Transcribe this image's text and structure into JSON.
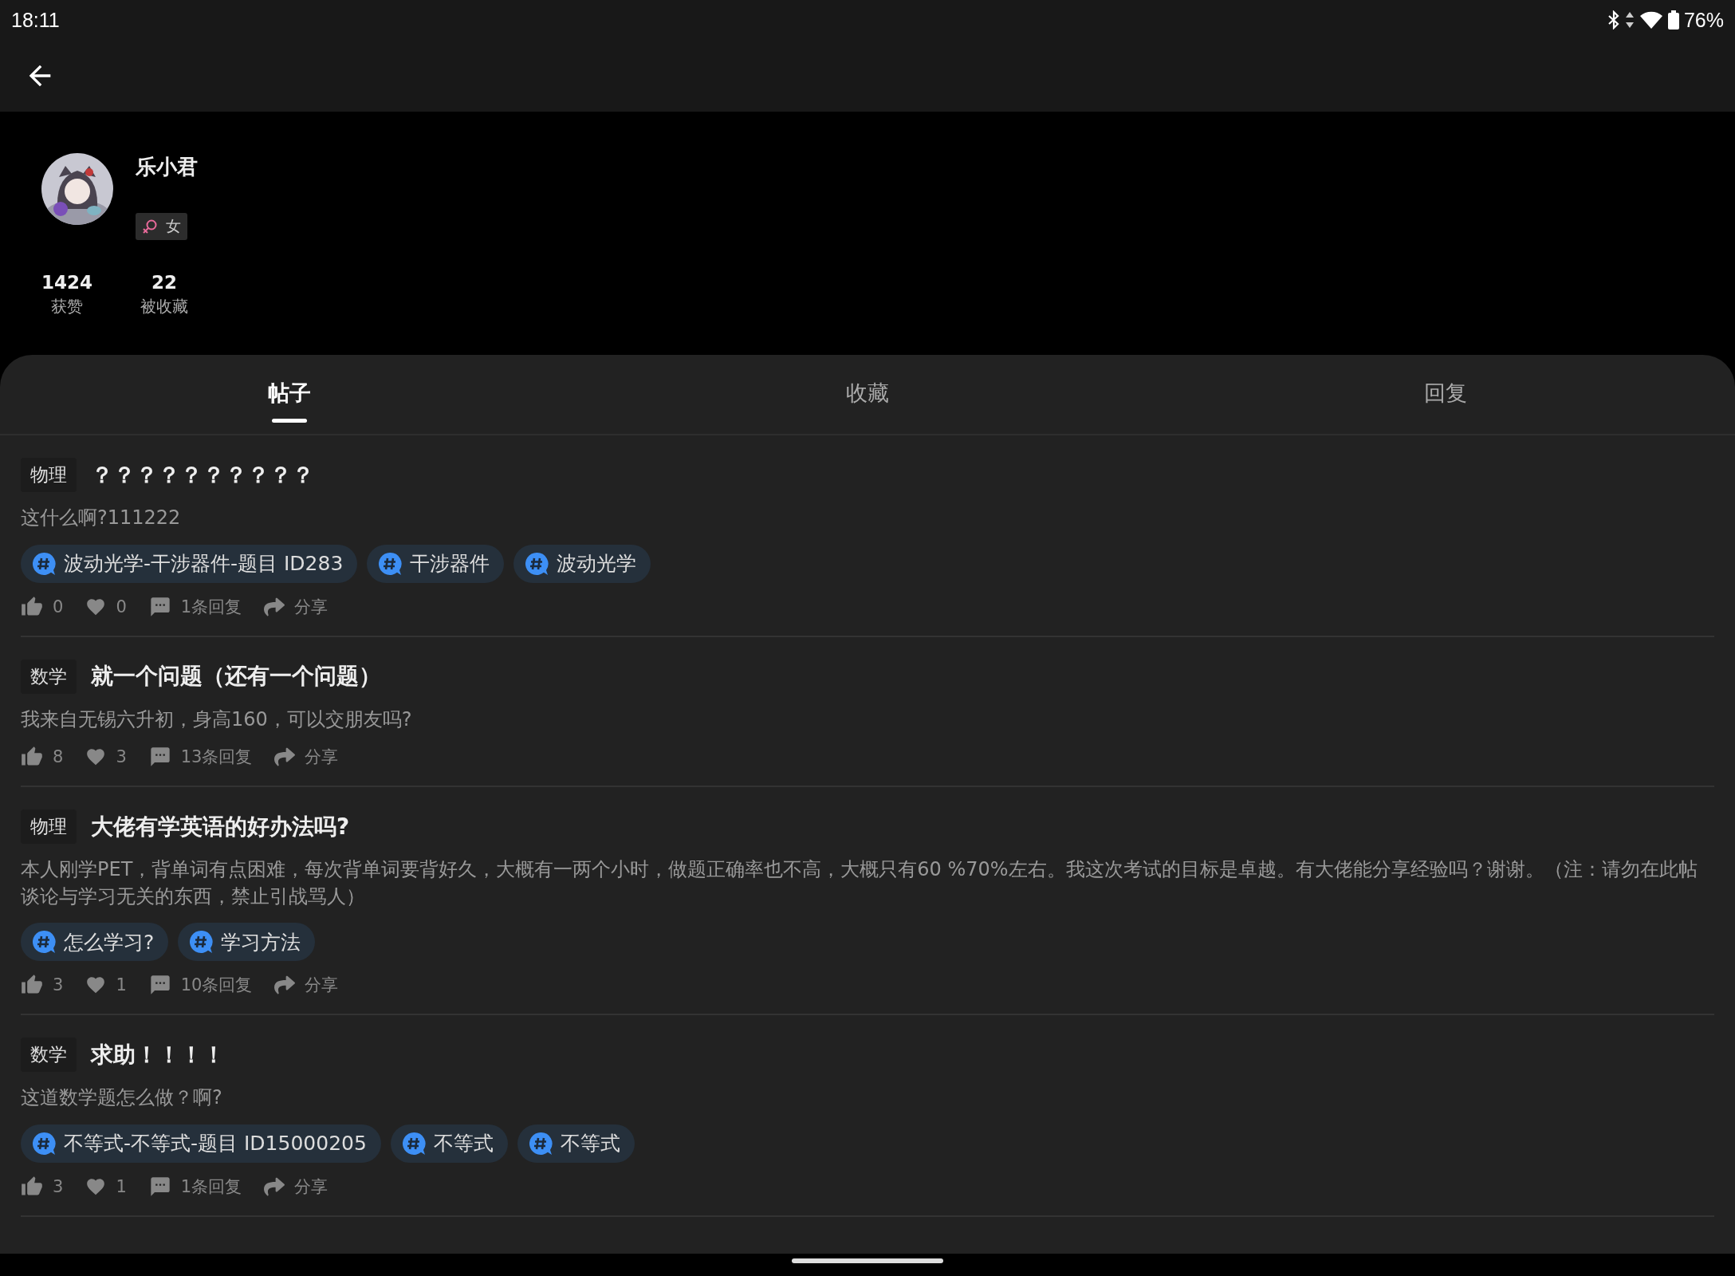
{
  "status_bar": {
    "time": "18:11",
    "battery": "76%"
  },
  "profile": {
    "name": "乐小君",
    "gender": "女",
    "stats": [
      {
        "value": "1424",
        "label": "获赞"
      },
      {
        "value": "22",
        "label": "被收藏"
      }
    ]
  },
  "tabs": [
    {
      "label": "帖子",
      "selected": true
    },
    {
      "label": "收藏",
      "selected": false
    },
    {
      "label": "回复",
      "selected": false
    }
  ],
  "posts": [
    {
      "subject": "物理",
      "title": "？？？？？？？？？？",
      "body": "这什么啊?111222",
      "tags": [
        "波动光学-干涉器件-题目 ID283",
        "干涉器件",
        "波动光学"
      ],
      "likes": "0",
      "favorites": "0",
      "replies": "1条回复",
      "share": "分享"
    },
    {
      "subject": "数学",
      "title": "就一个问题（还有一个问题）",
      "body": "我来自无锡六升初，身高160，可以交朋友吗?",
      "likes": "8",
      "favorites": "3",
      "replies": "13条回复",
      "share": "分享"
    },
    {
      "subject": "物理",
      "title": "大佬有学英语的好办法吗?",
      "body": "本人刚学PET，背单词有点困难，每次背单词要背好久，大概有一两个小时，做题正确率也不高，大概只有60 %70%左右。我这次考试的目标是卓越。有大佬能分享经验吗？谢谢。（注：请勿在此帖谈论与学习无关的东西，禁止引战骂人）",
      "tags": [
        "怎么学习?",
        "学习方法"
      ],
      "likes": "3",
      "favorites": "1",
      "replies": "10条回复",
      "share": "分享"
    },
    {
      "subject": "数学",
      "title": "求助！！！！",
      "body": "这道数学题怎么做？啊?",
      "tags": [
        "不等式-不等式-题目 ID15000205",
        "不等式",
        "不等式"
      ],
      "likes": "3",
      "favorites": "1",
      "replies": "1条回复",
      "share": "分享"
    }
  ]
}
